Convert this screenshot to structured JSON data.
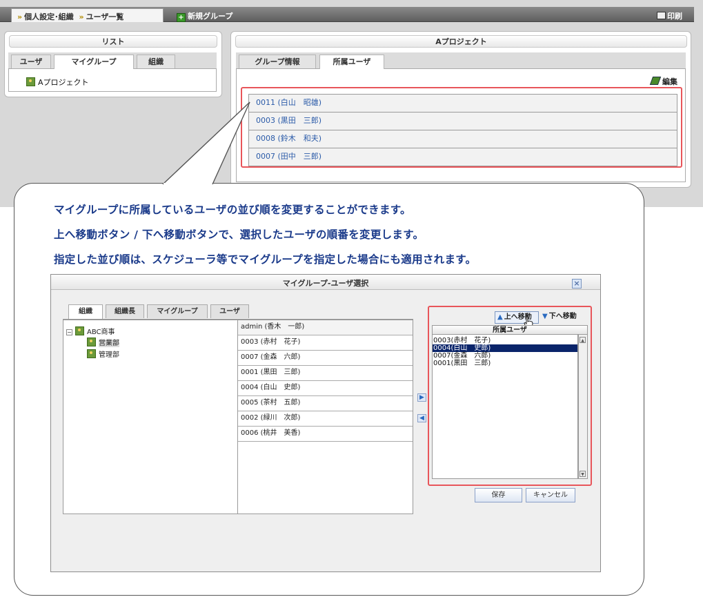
{
  "header": {
    "breadcrumb": "個人設定･組織 》ユーザ一覧",
    "breadcrumb_part1": "個人設定･組織",
    "breadcrumb_part2": "ユーザ一覧",
    "new_group": "新規グループ",
    "print": "印刷"
  },
  "list_panel": {
    "title": "リスト",
    "tabs": [
      "ユーザ",
      "マイグループ",
      "組織"
    ],
    "active_tab": "マイグループ",
    "items": [
      "Aプロジェクト"
    ]
  },
  "group_panel": {
    "title": "Aプロジェクト",
    "tabs": [
      "グループ情報",
      "所属ユーザ"
    ],
    "active_tab": "所属ユーザ",
    "edit": "編集",
    "members": [
      "0011 (白山　昭雄)",
      "0003 (黒田　三郎)",
      "0008 (鈴木　和夫)",
      "0007 (田中　三郎)"
    ]
  },
  "callout": {
    "lines": [
      "マイグループに所属しているユーザの並び順を変更することができます。",
      "上へ移動ボタン / 下へ移動ボタンで、選択したユーザの順番を変更します。",
      "指定した並び順は、スケジューラ等でマイグループを指定した場合にも適用されます。"
    ]
  },
  "dialog": {
    "title": "マイグループ-ユーザ選択",
    "tabs": [
      "組織",
      "組織長",
      "マイグループ",
      "ユーザ"
    ],
    "active_tab": "組織",
    "tree": {
      "root": "ABC商事",
      "children": [
        "営業部",
        "管理部"
      ]
    },
    "users": [
      "admin (香木　一郎)",
      "0003 (赤村　花子)",
      "0007 (金森　六郎)",
      "0001 (黒田　三郎)",
      "0004 (白山　史郎)",
      "0005 (茶村　五郎)",
      "0002 (緑川　次郎)",
      "0006 (桃井　美香)"
    ],
    "move_up": "上へ移動",
    "move_down": "下へ移動",
    "members_header": "所属ユーザ",
    "members": [
      "0003(赤村　花子)",
      "0004(白山　史郎)",
      "0007(金森　六郎)",
      "0001(黒田　三郎)"
    ],
    "selected_member": "0004(白山　史郎)",
    "save": "保存",
    "cancel": "キャンセル"
  },
  "colors": {
    "highlight_border": "#e8555a",
    "callout_text": "#1a3a8a",
    "link": "#2a5aa8",
    "selection": "#0a246a"
  }
}
